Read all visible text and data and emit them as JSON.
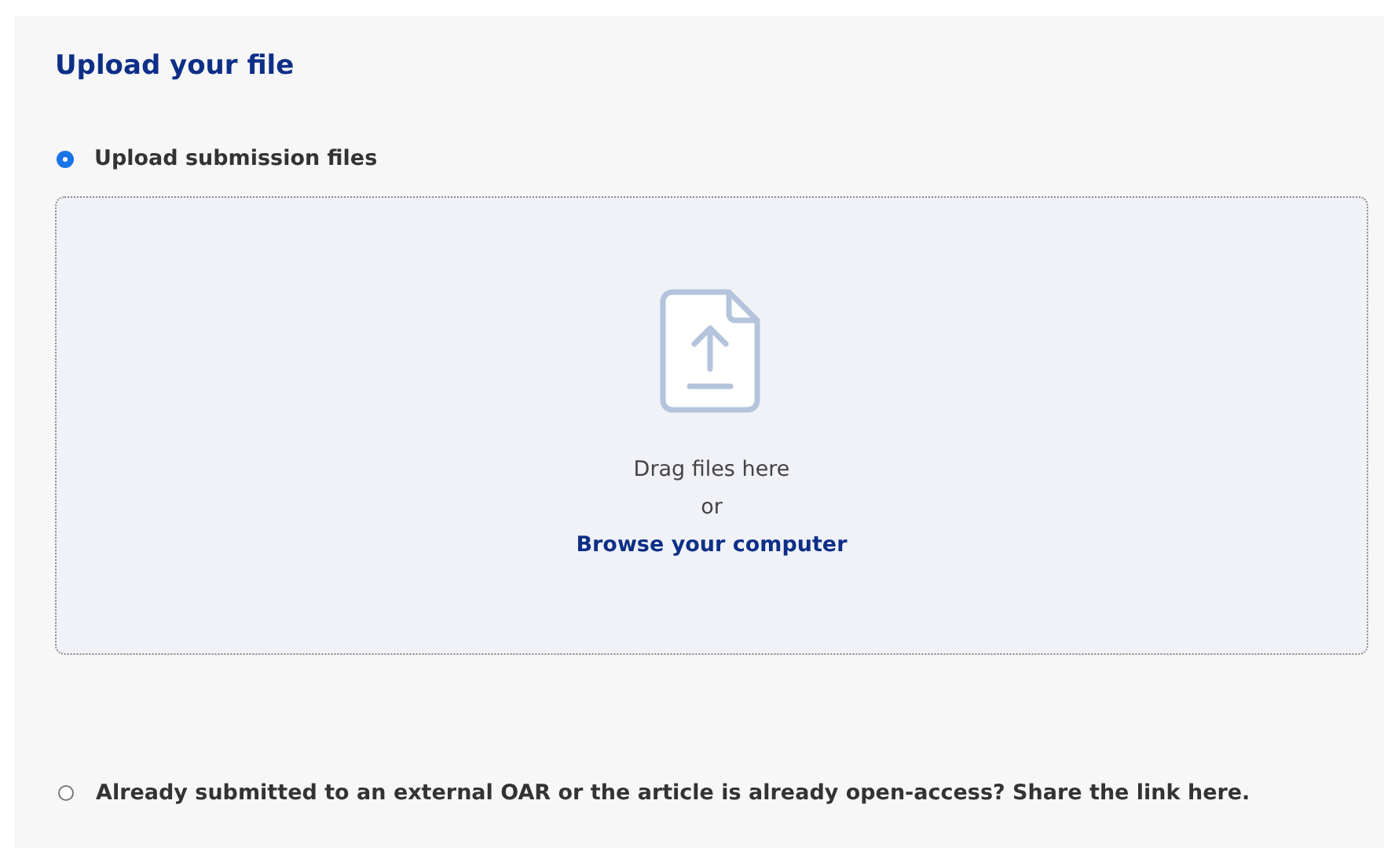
{
  "title": "Upload your file",
  "options": [
    {
      "label": "Upload submission files",
      "selected": true
    },
    {
      "label": "Already submitted to an external OAR or the article is already open-access? Share the link here.",
      "selected": false
    }
  ],
  "dropzone": {
    "hint": "Drag files here",
    "separator": "or",
    "link": "Browse your computer"
  }
}
